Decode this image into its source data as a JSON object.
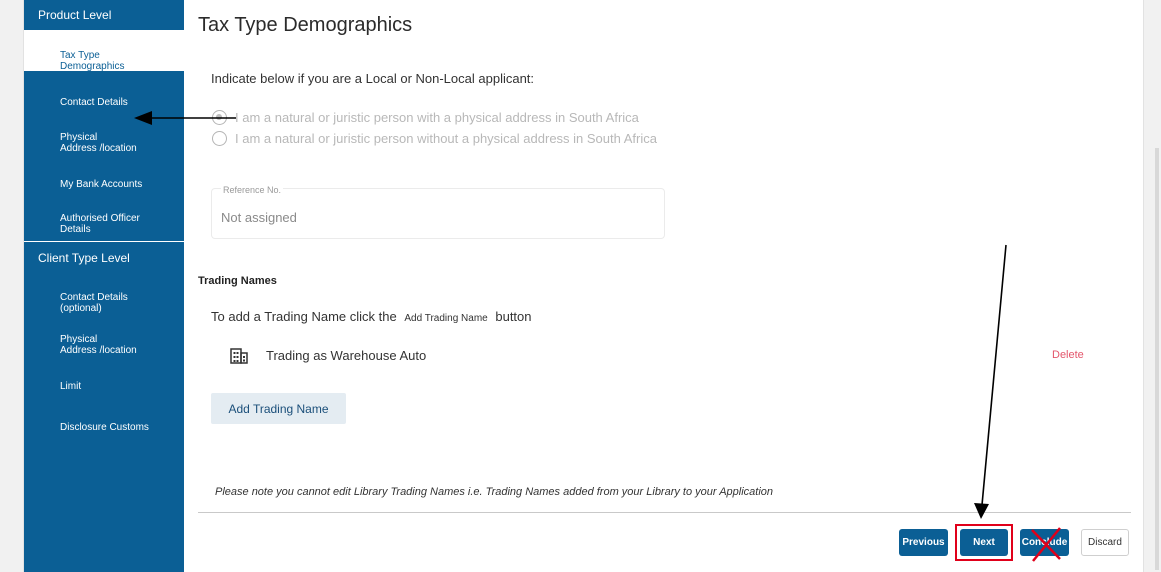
{
  "sidebar": {
    "product_level": "Product Level",
    "product_items": [
      {
        "label": "Tax Type\nDemographics"
      },
      {
        "label": "Contact Details"
      },
      {
        "label": "Physical\nAddress /location"
      },
      {
        "label": "My Bank Accounts"
      },
      {
        "label": "Authorised Officer\nDetails"
      }
    ],
    "client_type_level": "Client Type Level",
    "client_items": [
      {
        "label": "Contact Details\n(optional)"
      },
      {
        "label": "Physical\nAddress /location"
      },
      {
        "label": "Limit"
      },
      {
        "label": "Disclosure Customs"
      }
    ]
  },
  "main": {
    "title": "Tax Type Demographics",
    "instruction": "Indicate below if you are a Local or Non-Local applicant:",
    "radio_options": [
      {
        "label": "I am a natural or juristic person with a physical address in South Africa",
        "checked": true
      },
      {
        "label": "I am a natural or juristic person without a physical address in South Africa",
        "checked": false
      }
    ],
    "reference": {
      "label": "Reference No.",
      "value": "Not assigned"
    },
    "trading": {
      "section_title": "Trading Names",
      "help_prefix": "To add a Trading Name click the",
      "help_button": "Add Trading Name",
      "help_suffix": "button",
      "entries": [
        {
          "name": "Trading as Warehouse Auto",
          "delete_label": "Delete"
        }
      ],
      "add_button": "Add Trading Name"
    },
    "note": "Please note  you cannot edit Library Trading Names i.e. Trading Names added from your Library to your Application"
  },
  "footer": {
    "previous": "Previous",
    "next": "Next",
    "conclude": "Conclude",
    "discard": "Discard"
  },
  "colors": {
    "sidebar_bg": "#0b5f95",
    "delete": "#e3556b",
    "highlight": "#e0001a"
  },
  "icons": {
    "building": "building-icon"
  }
}
